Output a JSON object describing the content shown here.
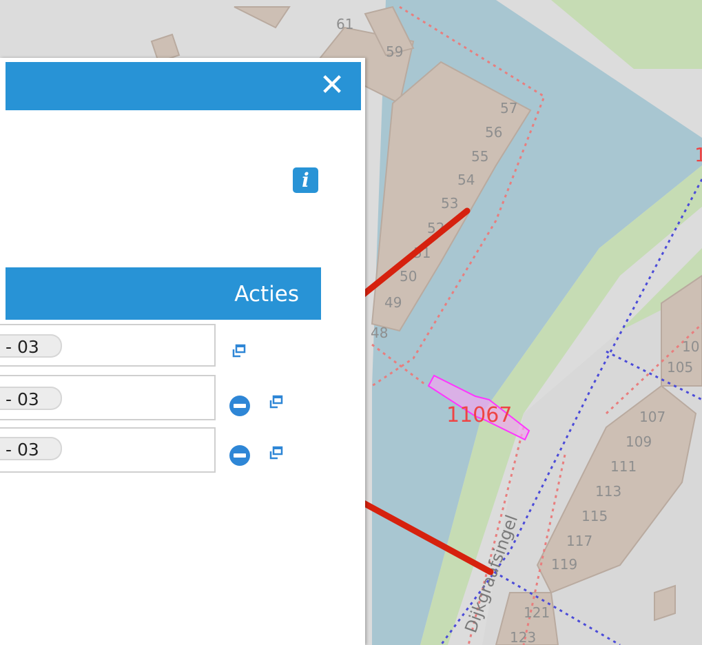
{
  "panel": {
    "close_label": "✕",
    "info_label": "i",
    "table_header": {
      "acties": "Acties"
    },
    "rows": [
      {
        "chip": " - 03",
        "has_minus": false
      },
      {
        "chip": " - 03",
        "has_minus": true
      },
      {
        "chip": " - 03",
        "has_minus": true
      }
    ]
  },
  "map": {
    "street_name": "Dijkgraafsingel",
    "parcel_label": "11067",
    "partial_red_label": "1",
    "house_numbers": [
      "61",
      "59",
      "57",
      "56",
      "55",
      "54",
      "53",
      "52",
      "51",
      "50",
      "49",
      "48",
      "107",
      "109",
      "111",
      "113",
      "115",
      "117",
      "119",
      "121",
      "123",
      "10",
      "105"
    ]
  },
  "colors": {
    "accent": "#2893d6",
    "water": "#aac8d2",
    "parcel": "#ff33ff",
    "arrow": "#d6210e"
  }
}
